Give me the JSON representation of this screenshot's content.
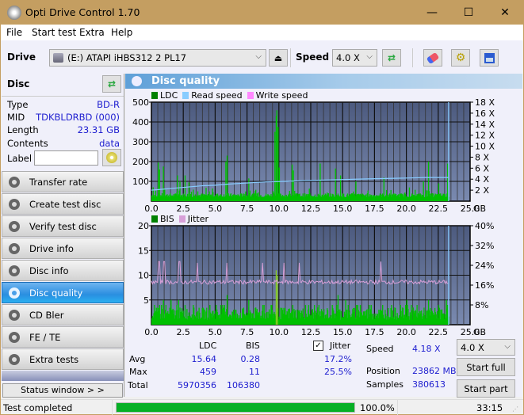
{
  "window": {
    "title": "Opti Drive Control 1.70",
    "minimize": "—",
    "maximize": "☐",
    "close": "✕"
  },
  "menu": [
    "File",
    "Start test",
    "Extra",
    "Help"
  ],
  "toolbar": {
    "drive_label": "Drive",
    "drive_value": "(E:)   ATAPI iHBS312   2 PL17",
    "speed_label": "Speed",
    "speed_value": "4.0 X"
  },
  "disc": {
    "header": "Disc",
    "fields": [
      {
        "key": "Type",
        "value": "BD-R"
      },
      {
        "key": "MID",
        "value": "TDKBLDRBD (000)"
      },
      {
        "key": "Length",
        "value": "23.31 GB"
      },
      {
        "key": "Contents",
        "value": "data"
      }
    ],
    "label_key": "Label",
    "label_value": ""
  },
  "nav": [
    {
      "label": "Transfer rate",
      "active": false
    },
    {
      "label": "Create test disc",
      "active": false
    },
    {
      "label": "Verify test disc",
      "active": false
    },
    {
      "label": "Drive info",
      "active": false
    },
    {
      "label": "Disc info",
      "active": false
    },
    {
      "label": "Disc quality",
      "active": true
    },
    {
      "label": "CD Bler",
      "active": false
    },
    {
      "label": "FE / TE",
      "active": false
    },
    {
      "label": "Extra tests",
      "active": false
    }
  ],
  "status_window_button": "Status window > >",
  "panel": {
    "title": "Disc quality"
  },
  "colors": {
    "ldc": "#00c000",
    "bis": "#00c000",
    "read_speed": "#88ccff",
    "write_speed": "#ff88ff",
    "jitter": "#d8a0d8",
    "plot_bg_top": "#4c5a7e",
    "plot_bg_bottom": "#7a8ab0",
    "accent": "#2a8ee0"
  },
  "chart_data": [
    {
      "type": "bar",
      "title": "LDC / Read speed",
      "legend": [
        "LDC",
        "Read speed",
        "Write speed"
      ],
      "legend_position": "top-left",
      "xlabel": "GB",
      "x_ticks": [
        "0.0",
        "2.5",
        "5.0",
        "7.5",
        "10.0",
        "12.5",
        "15.0",
        "17.5",
        "20.0",
        "22.5",
        "25.0"
      ],
      "xlim": [
        0,
        25
      ],
      "y_ticks_left": [
        "100",
        "200",
        "300",
        "400",
        "500"
      ],
      "ylim_left": [
        0,
        500
      ],
      "y_ticks_right": [
        "2 X",
        "4 X",
        "6 X",
        "8 X",
        "10 X",
        "12 X",
        "14 X",
        "16 X",
        "18 X"
      ],
      "ylim_right": [
        0,
        18
      ],
      "grid": true,
      "test_end_gb": 23.31,
      "ldc_peaks": [
        {
          "x": 0.1,
          "y": 70
        },
        {
          "x": 0.5,
          "y": 195
        },
        {
          "x": 0.6,
          "y": 160
        },
        {
          "x": 0.9,
          "y": 175
        },
        {
          "x": 2.0,
          "y": 130
        },
        {
          "x": 2.2,
          "y": 100
        },
        {
          "x": 2.6,
          "y": 130
        },
        {
          "x": 2.9,
          "y": 95
        },
        {
          "x": 5.8,
          "y": 200
        },
        {
          "x": 5.9,
          "y": 230
        },
        {
          "x": 7.6,
          "y": 115
        },
        {
          "x": 9.65,
          "y": 350
        },
        {
          "x": 9.75,
          "y": 430
        },
        {
          "x": 9.8,
          "y": 459
        },
        {
          "x": 9.9,
          "y": 375
        },
        {
          "x": 10.0,
          "y": 170
        },
        {
          "x": 11.0,
          "y": 185
        },
        {
          "x": 11.1,
          "y": 155
        },
        {
          "x": 13.2,
          "y": 190
        },
        {
          "x": 14.4,
          "y": 165
        },
        {
          "x": 14.8,
          "y": 130
        },
        {
          "x": 16.0,
          "y": 100
        },
        {
          "x": 18.2,
          "y": 120
        },
        {
          "x": 21.3,
          "y": 100
        },
        {
          "x": 21.7,
          "y": 200
        },
        {
          "x": 22.5,
          "y": 90
        },
        {
          "x": 23.2,
          "y": 190
        }
      ],
      "ldc_baseline": 35,
      "read_speed": [
        {
          "x": 0,
          "y": 2.0
        },
        {
          "x": 1.0,
          "y": 2.2
        },
        {
          "x": 2.0,
          "y": 2.4
        },
        {
          "x": 3.0,
          "y": 2.6
        },
        {
          "x": 4.0,
          "y": 2.8
        },
        {
          "x": 5.0,
          "y": 2.9
        },
        {
          "x": 6.0,
          "y": 3.1
        },
        {
          "x": 7.5,
          "y": 3.3
        },
        {
          "x": 9.0,
          "y": 3.5
        },
        {
          "x": 10.5,
          "y": 3.6
        },
        {
          "x": 12.0,
          "y": 3.75
        },
        {
          "x": 14.5,
          "y": 3.9
        },
        {
          "x": 16.0,
          "y": 4.0
        },
        {
          "x": 18.0,
          "y": 4.1
        },
        {
          "x": 20.0,
          "y": 4.2
        },
        {
          "x": 21.5,
          "y": 4.3
        },
        {
          "x": 23.31,
          "y": 4.3
        }
      ]
    },
    {
      "type": "bar",
      "title": "BIS / Jitter",
      "legend": [
        "BIS",
        "Jitter"
      ],
      "legend_position": "top-left",
      "xlabel": "GB",
      "x_ticks": [
        "0.0",
        "2.5",
        "5.0",
        "7.5",
        "10.0",
        "12.5",
        "15.0",
        "17.5",
        "20.0",
        "22.5",
        "25.0"
      ],
      "xlim": [
        0,
        25
      ],
      "y_ticks_left": [
        "5",
        "10",
        "15",
        "20"
      ],
      "ylim_left": [
        0,
        20
      ],
      "y_ticks_right": [
        "8%",
        "16%",
        "24%",
        "32%",
        "40%"
      ],
      "ylim_right": [
        0,
        40
      ],
      "grid": true,
      "test_end_gb": 23.31,
      "bis_peaks": [
        {
          "x": 0.2,
          "y": 4
        },
        {
          "x": 0.6,
          "y": 4
        },
        {
          "x": 0.9,
          "y": 5
        },
        {
          "x": 1.5,
          "y": 5
        },
        {
          "x": 2.1,
          "y": 5
        },
        {
          "x": 2.6,
          "y": 4
        },
        {
          "x": 5.9,
          "y": 6
        },
        {
          "x": 7.6,
          "y": 5
        },
        {
          "x": 9.75,
          "y": 11
        },
        {
          "x": 9.85,
          "y": 10
        },
        {
          "x": 14.6,
          "y": 6
        },
        {
          "x": 15.2,
          "y": 5
        },
        {
          "x": 20.0,
          "y": 5
        },
        {
          "x": 21.7,
          "y": 5
        },
        {
          "x": 23.1,
          "y": 5
        }
      ],
      "bis_baseline": 3,
      "jitter_baseline_pct": 17.2,
      "jitter_spikes": [
        {
          "x": 0.6,
          "y": 25.5
        },
        {
          "x": 1.0,
          "y": 25.5
        },
        {
          "x": 2.2,
          "y": 25.5
        },
        {
          "x": 3.6,
          "y": 25
        },
        {
          "x": 5.9,
          "y": 25
        },
        {
          "x": 8.7,
          "y": 25
        },
        {
          "x": 10.4,
          "y": 25
        },
        {
          "x": 11.6,
          "y": 25
        },
        {
          "x": 18.0,
          "y": 25.5
        }
      ]
    }
  ],
  "stats": {
    "headers": [
      "LDC",
      "BIS"
    ],
    "rows": [
      {
        "label": "Avg",
        "ldc": "15.64",
        "bis": "0.28",
        "jitter": "17.2%"
      },
      {
        "label": "Max",
        "ldc": "459",
        "bis": "11",
        "jitter": "25.5%"
      },
      {
        "label": "Total",
        "ldc": "5970356",
        "bis": "106380"
      }
    ],
    "jitter_label": "Jitter",
    "jitter_checked": true,
    "speed_label": "Speed",
    "speed_value": "4.18 X",
    "position_label": "Position",
    "position_value": "23862 MB",
    "samples_label": "Samples",
    "samples_value": "380613",
    "speed_select": "4.0 X",
    "start_full": "Start full",
    "start_part": "Start part"
  },
  "statusbar": {
    "text": "Test completed",
    "progress_pct": 100,
    "progress_label": "100.0%",
    "time": "33:15"
  }
}
